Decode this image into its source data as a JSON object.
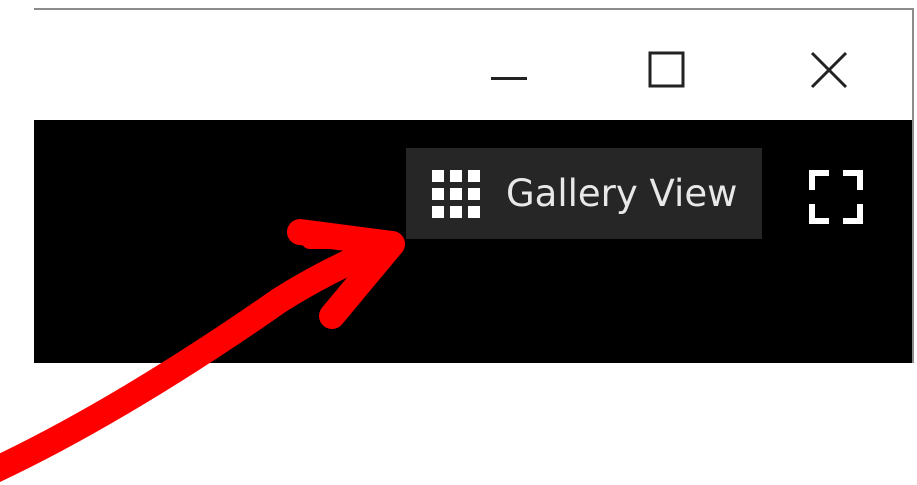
{
  "window": {
    "minimize_icon": "minimize-icon",
    "maximize_icon": "maximize-icon",
    "close_icon": "close-icon"
  },
  "toolbar": {
    "gallery_view_label": "Gallery View",
    "gallery_view_icon": "grid-icon",
    "fullscreen_icon": "fullscreen-icon"
  },
  "annotation": {
    "arrow_color": "#ff0000",
    "arrow_icon": "red-arrow"
  },
  "colors": {
    "video_background": "#000000",
    "button_background": "#262626",
    "button_text": "#e8e8e8"
  }
}
